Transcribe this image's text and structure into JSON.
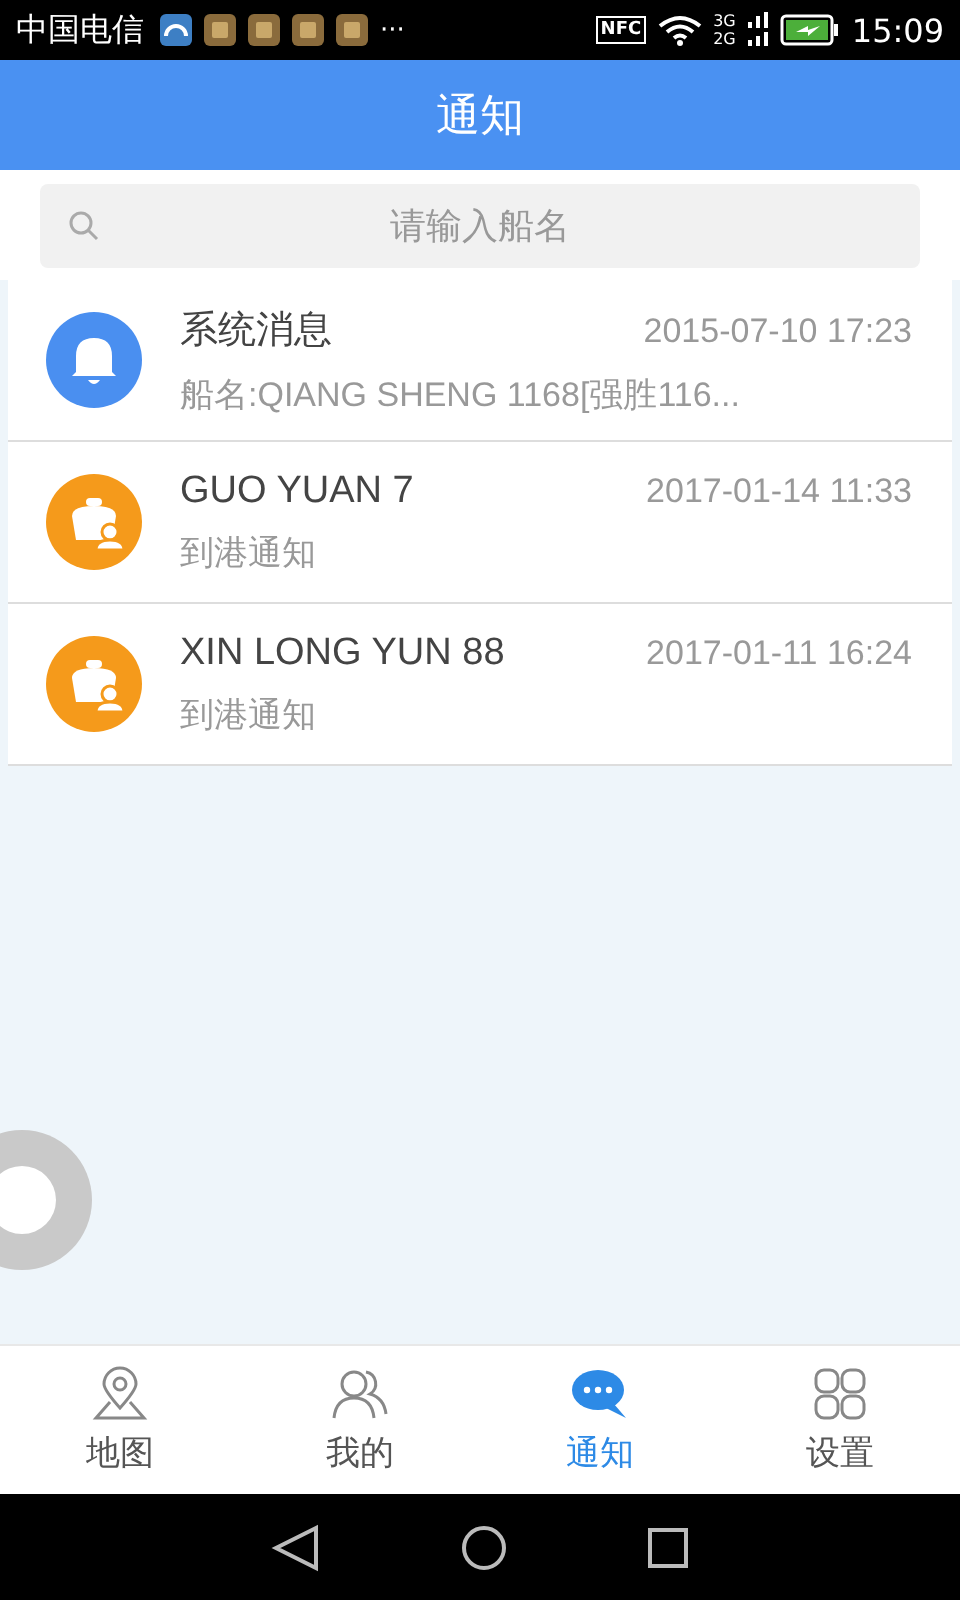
{
  "status_bar": {
    "carrier": "中国电信",
    "more": "···",
    "nfc": "NFC",
    "network_labels": [
      "3G",
      "2G"
    ],
    "time": "15:09"
  },
  "header": {
    "title": "通知"
  },
  "search": {
    "placeholder": "请输入船名"
  },
  "messages": [
    {
      "kind": "system",
      "title": "系统消息",
      "time": "2015-07-10 17:23",
      "preview": "船名:QIANG SHENG 1168[强胜116..."
    },
    {
      "kind": "ship",
      "title": "GUO YUAN 7",
      "time": "2017-01-14 11:33",
      "preview": "到港通知"
    },
    {
      "kind": "ship",
      "title": "XIN LONG YUN 88",
      "time": "2017-01-11 16:24",
      "preview": "到港通知"
    }
  ],
  "tabs": [
    {
      "kind": "map",
      "label": "地图",
      "selected": false
    },
    {
      "kind": "people",
      "label": "我的",
      "selected": false
    },
    {
      "kind": "chat",
      "label": "通知",
      "selected": true
    },
    {
      "kind": "grid",
      "label": "设置",
      "selected": false
    }
  ]
}
